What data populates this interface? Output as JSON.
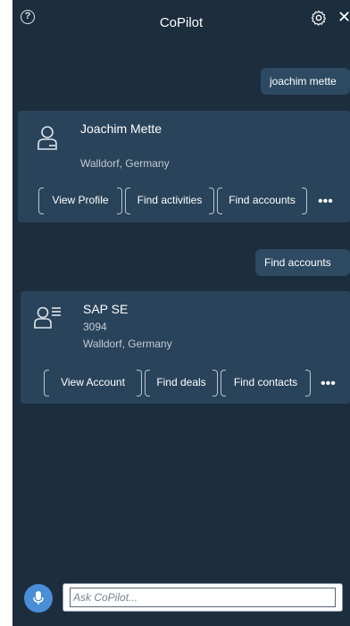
{
  "header": {
    "title": "CoPilot",
    "help_icon": "question-circle-icon",
    "settings_icon": "gear-icon",
    "close_icon": "close-icon",
    "close_glyph": "✕"
  },
  "messages": [
    {
      "type": "user",
      "text": "joachim mette"
    },
    {
      "type": "card",
      "icon": "person-icon",
      "title": "Joachim Mette",
      "lines": [
        "Walldorf, Germany"
      ],
      "actions": [
        "View Profile",
        "Find activities",
        "Find accounts"
      ],
      "more": "•••"
    },
    {
      "type": "user",
      "text": "Find accounts"
    },
    {
      "type": "card",
      "icon": "account-list-icon",
      "title": "SAP SE",
      "lines": [
        "3094",
        "Walldorf, Germany"
      ],
      "actions": [
        "View Account",
        "Find deals",
        "Find contacts"
      ],
      "more": "•••"
    }
  ],
  "input": {
    "placeholder": "Ask CoPilot...",
    "value": "",
    "mic_icon": "microphone-icon"
  },
  "colors": {
    "background": "#1c2d3e",
    "card": "#29435a",
    "bubble": "#2d4a62",
    "accent": "#4a8ed8"
  }
}
